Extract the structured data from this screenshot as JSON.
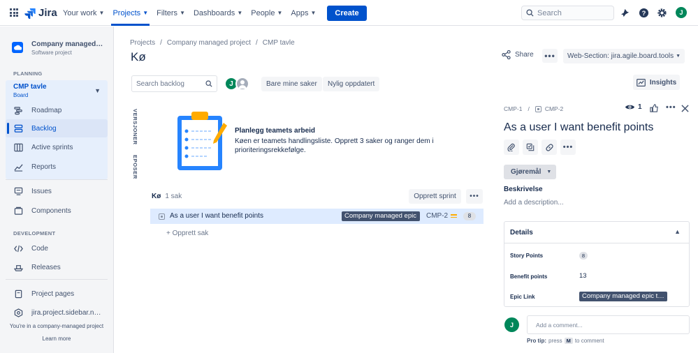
{
  "topnav": {
    "logo": "Jira",
    "items": [
      {
        "label": "Your work"
      },
      {
        "label": "Projects"
      },
      {
        "label": "Filters"
      },
      {
        "label": "Dashboards"
      },
      {
        "label": "People"
      },
      {
        "label": "Apps"
      }
    ],
    "create_label": "Create",
    "search_placeholder": "Search",
    "user_initial": "J"
  },
  "sidebar": {
    "project_name": "Company managed project",
    "project_type": "Software project",
    "planning_title": "PLANNING",
    "board_name": "CMP tavle",
    "board_type": "Board",
    "planning_items": [
      "Roadmap",
      "Backlog",
      "Active sprints",
      "Reports"
    ],
    "other_items": [
      "Issues",
      "Components"
    ],
    "development_title": "DEVELOPMENT",
    "dev_items": [
      "Code",
      "Releases"
    ],
    "bottom_items": [
      "Project pages",
      "jira.project.sidebar.navigation"
    ],
    "footer_text": "You're in a company-managed project",
    "learn_more": "Learn more"
  },
  "main": {
    "breadcrumb": [
      "Projects",
      "Company managed project",
      "CMP tavle"
    ],
    "title": "Kø",
    "search_placeholder": "Search backlog",
    "avatar_initial": "J",
    "filter_mine": "Bare mine saker",
    "filter_recent": "Nylig oppdatert",
    "tab_versions": "VERSJONER",
    "tab_epics": "EPOSER",
    "empty_title": "Planlegg teamets arbeid",
    "empty_desc": "Køen er teamets handlingsliste. Opprett 3 saker og ranger dem i prioriteringsrekkefølge.",
    "backlog_label": "Kø",
    "backlog_count": "1 sak",
    "create_sprint": "Opprett sprint",
    "issue": {
      "summary": "As a user I want benefit points",
      "epic": "Company managed epic",
      "key": "CMP-2",
      "story_points": "8"
    },
    "create_issue": "+ Opprett sak"
  },
  "header_right": {
    "share": "Share",
    "web_section": "Web-Section: jira.agile.board.tools",
    "insights": "Insights"
  },
  "detail": {
    "parent_key": "CMP-1",
    "key": "CMP-2",
    "watchers": "1",
    "title": "As a user I want benefit points",
    "status": "Gjøremål",
    "desc_label": "Beskrivelse",
    "desc_placeholder": "Add a description...",
    "details_label": "Details",
    "fields": {
      "story_points_label": "Story Points",
      "story_points_value": "8",
      "benefit_label": "Benefit points",
      "benefit_value": "13",
      "epic_label": "Epic Link",
      "epic_value": "Company managed epic test"
    },
    "comment_initial": "J",
    "comment_placeholder": "Add a comment...",
    "protip_label": "Pro tip:",
    "protip_pre": "press",
    "protip_key": "M",
    "protip_post": "to comment"
  },
  "colors": {
    "brand": "#0052cc",
    "avatar_green": "#00875a",
    "epic_bg": "#42526e",
    "selected_row": "#deebff"
  }
}
